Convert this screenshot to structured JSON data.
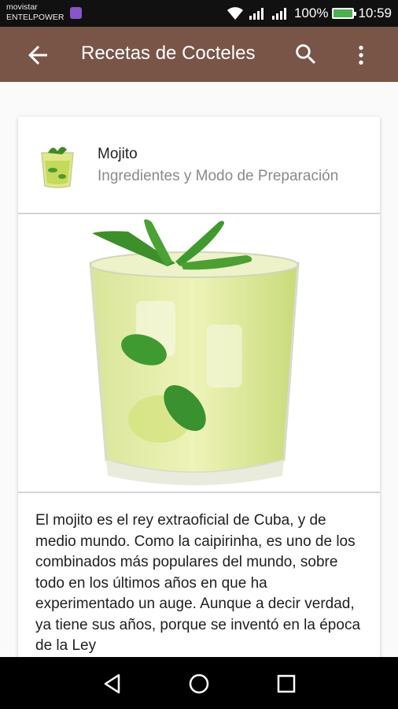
{
  "status_bar": {
    "carrier_line1": "movistar",
    "carrier_line2": "ENTELPOWER",
    "battery_percent": "100%",
    "time": "10:59"
  },
  "app_bar": {
    "title": "Recetas de Cocteles",
    "color": "#795548",
    "icons": [
      "back-arrow-icon",
      "search-icon",
      "more-vert-icon"
    ]
  },
  "recipe": {
    "title": "Mojito",
    "subtitle": "Ingredientes y Modo de Preparación",
    "description": "El mojito es el rey extraoficial de Cuba, y de medio mundo. Como la caipirinha, es uno de los combinados más populares del mundo, sobre todo en los últimos años en que ha experimentado un auge. Aunque a decir verdad, ya tiene sus años, porque se inventó en la época de la Ley"
  },
  "nav_bar": {
    "icons": [
      "back-triangle-icon",
      "home-circle-icon",
      "recents-square-icon"
    ]
  }
}
